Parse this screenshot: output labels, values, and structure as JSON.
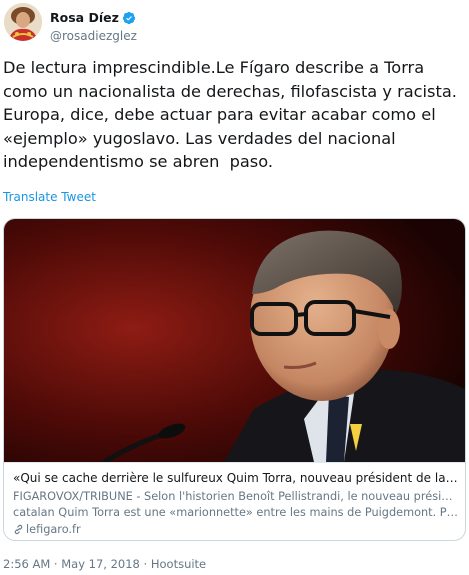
{
  "author": {
    "display_name": "Rosa Díez",
    "handle": "@rosadiezglez",
    "verified_icon": "verified-badge-icon"
  },
  "tweet": {
    "text": "De lectura imprescindible.Le Fígaro describe a Torra como un nacionalista de derechas, filofascista y racista. Europa, dice, debe actuar para evitar acabar como el «ejemplo» yugoslavo. Las verdades del nacional independentismo se abren  paso.",
    "translate_label": "Translate Tweet"
  },
  "card": {
    "title": "«Qui se cache derrière le sulfureux Quim Torra, nouveau président de la Catalog…",
    "description_line1": "FIGAROVOX/TRIBUNE - Selon l'historien Benoît Pellistrandi, le nouveau président",
    "description_line2": "catalan Quim Torra est une «marionnette» entre les mains de Puigdemont. Plus …",
    "domain": "lefigaro.fr",
    "domain_icon": "link-icon"
  },
  "meta": {
    "timestamp": "2:56 AM · May 17, 2018 · Hootsuite"
  },
  "colors": {
    "link": "#1b95e0",
    "secondary": "#657786",
    "verified": "#1da1f2",
    "border": "#ccd6dd"
  }
}
